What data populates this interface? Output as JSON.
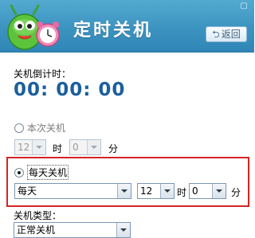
{
  "header": {
    "title": "定时关机",
    "back_label": "返回",
    "back_icon": "return-arrow-icon",
    "mascot_icon": "green-mascot-with-alarm-clock",
    "topright_icon": "restore-window-icon"
  },
  "countdown": {
    "label": "关机倒计时：",
    "value": "00: 00: 00"
  },
  "once": {
    "label": "本次关机",
    "selected": false,
    "hour": "12",
    "hour_unit": "时",
    "minute": "0",
    "minute_unit": "分"
  },
  "daily": {
    "label": "每天关机",
    "selected": true,
    "repeat": "每天",
    "hour": "12",
    "hour_unit": "时",
    "minute": "0",
    "minute_unit": "分"
  },
  "shutdown_type": {
    "label": "关机类型：",
    "value": "正常关机"
  },
  "colors": {
    "header_blue": "#3d93c0",
    "countdown_blue": "#1b5f9e",
    "highlight_red": "#d42424"
  }
}
